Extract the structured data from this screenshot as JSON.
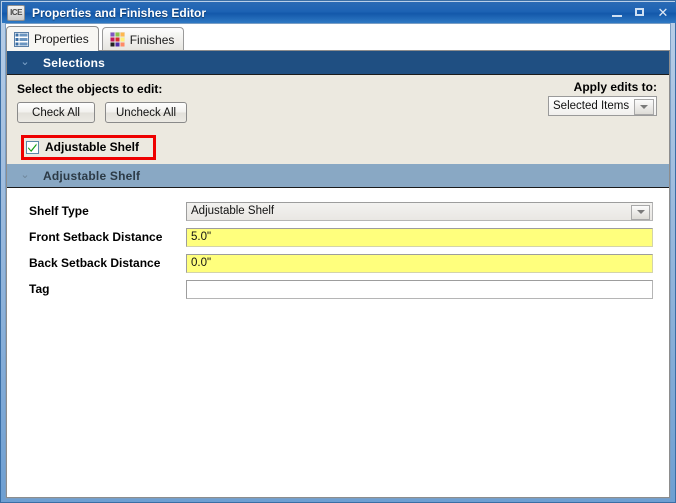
{
  "window": {
    "app_icon_text": "ICE",
    "title": "Properties and Finishes Editor",
    "minimize_label": "Minimize",
    "maximize_label": "Maximize",
    "close_label": "✕"
  },
  "tabs": [
    {
      "label": "Properties",
      "icon": "list-icon",
      "active": true
    },
    {
      "label": "Finishes",
      "icon": "color-swatches-icon",
      "active": false
    }
  ],
  "selections": {
    "header_title": "Selections",
    "chevron": "⌄",
    "instruction": "Select the objects to edit:",
    "check_all_label": "Check All",
    "uncheck_all_label": "Uncheck All",
    "apply_edits_label": "Apply edits to:",
    "apply_edits_value": "Selected Items",
    "object_checkbox": {
      "label": "Adjustable Shelf",
      "checked": true,
      "highlight_color": "#ee0000"
    }
  },
  "adjustable_shelf_section": {
    "header_title": "Adjustable Shelf",
    "chevron": "⌄",
    "fields": [
      {
        "label": "Shelf Type",
        "value": "Adjustable Shelf",
        "type": "combo"
      },
      {
        "label": "Front Setback Distance",
        "value": "5.0\"",
        "type": "yellow"
      },
      {
        "label": "Back Setback Distance",
        "value": "0.0\"",
        "type": "yellow"
      },
      {
        "label": "Tag",
        "value": "",
        "type": "plain"
      }
    ]
  },
  "colors": {
    "titlebar_blue": "#1d62b4",
    "section_primary": "#1f4f82",
    "section_secondary": "#89a8c4",
    "panel_beige": "#ece9e0",
    "field_highlight_yellow": "#ffff7d",
    "annotation_red": "#ee0000"
  }
}
